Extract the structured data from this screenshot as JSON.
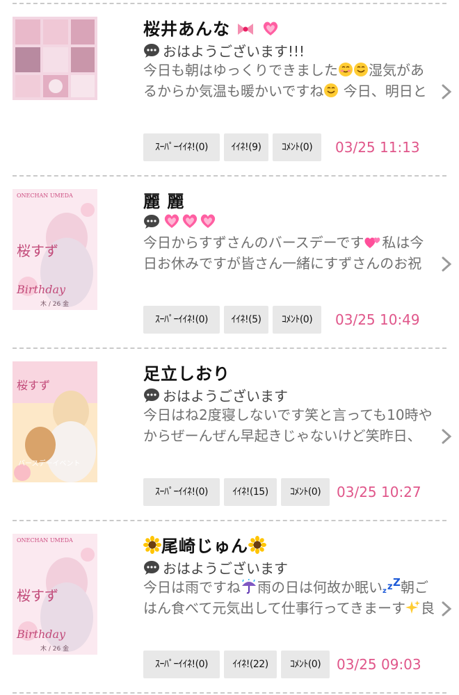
{
  "posts": [
    {
      "author": "桜井あんな",
      "author_suffix_emoji": [
        "ribbon",
        "sparkling-heart"
      ],
      "subject": "おはようございます!!!",
      "excerpt_parts": [
        "今日も朝はゆっくりできました",
        "[smiling-blush]",
        "[smiling]",
        "湿気があるからか気温も暖かいですね",
        "[smiling]",
        " 今日、明日と"
      ],
      "super_like": "ｽｰﾊﾟｰｲｲﾈ!(0)",
      "like": "ｲｲﾈ!(9)",
      "comment": "ｺﾒﾝﾄ(0)",
      "date": "03/25 11:13",
      "thumb_alt": "collage photo"
    },
    {
      "author": "麗 麗",
      "subject_emoji": [
        "sparkling-heart",
        "sparkling-heart",
        "sparkling-heart"
      ],
      "subject": "",
      "excerpt_parts": [
        "今日からすずさんのバースデーです",
        "[two-hearts]",
        "私は今日お休みですが皆さん一緒にすずさんのお祝"
      ],
      "super_like": "ｽｰﾊﾟｰｲｲﾈ!(0)",
      "like": "ｲｲﾈ!(5)",
      "comment": "ｺﾒﾝﾄ(0)",
      "date": "03/25 10:49",
      "thumb_text": [
        "ONECHAN UMEDA",
        "桜すず",
        "Birthday",
        "木 / 26 金"
      ]
    },
    {
      "author": "足立しおり",
      "subject": "おはようございます",
      "excerpt_parts": [
        "今日はね2度寝しないです笑と言っても10時やからぜーんぜん早起きじゃないけど笑昨日、"
      ],
      "super_like": "ｽｰﾊﾟｰｲｲﾈ!(0)",
      "like": "ｲｲﾈ!(15)",
      "comment": "ｺﾒﾝﾄ(0)",
      "date": "03/25 10:27",
      "thumb_text": [
        "桜すず",
        "バースデーイベント"
      ]
    },
    {
      "author": "尾崎じゅん",
      "author_wrap_emoji": "sunflower",
      "subject": "おはようございます",
      "excerpt_parts": [
        "今日は雨ですね",
        "[umbrella-rain]",
        "雨の日は何故か眠い",
        "[zzz]",
        "朝ごはん食べて元気出して仕事行ってきまーす",
        "[sparkles]",
        "良"
      ],
      "super_like": "ｽｰﾊﾟｰｲｲﾈ!(0)",
      "like": "ｲｲﾈ!(22)",
      "comment": "ｺﾒﾝﾄ(0)",
      "date": "03/25 09:03",
      "thumb_text": [
        "ONECHAN UMEDA",
        "桜すず",
        "Birthday",
        "木 / 26 金"
      ]
    }
  ],
  "colors": {
    "date": "#e0568a",
    "button_bg": "#e8e8e8",
    "divider": "#c9c9c9",
    "excerpt": "#6f6f6f"
  }
}
